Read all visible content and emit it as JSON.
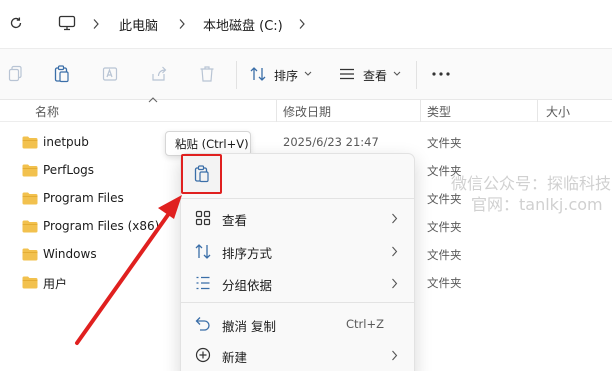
{
  "address_bar": {
    "crumbs": [
      "此电脑",
      "本地磁盘 (C:)"
    ]
  },
  "toolbar": {
    "sort_label": "排序",
    "view_label": "查看"
  },
  "columns": {
    "name": "名称",
    "date": "修改日期",
    "type": "类型",
    "size": "大小"
  },
  "files": [
    {
      "name": "inetpub",
      "date": "2025/6/23 21:47",
      "type": "文件夹"
    },
    {
      "name": "PerfLogs",
      "date": "",
      "type": "文件夹"
    },
    {
      "name": "Program Files",
      "date": "",
      "type": "文件夹"
    },
    {
      "name": "Program Files (x86)",
      "date": "",
      "type": "文件夹"
    },
    {
      "name": "Windows",
      "date": "",
      "type": "文件夹"
    },
    {
      "name": "用户",
      "date": "",
      "type": "文件夹"
    }
  ],
  "tooltip": {
    "text": "粘贴 (Ctrl+V)"
  },
  "context_menu": {
    "items": [
      {
        "label": "查看",
        "icon": "grid-view-icon",
        "submenu": true
      },
      {
        "label": "排序方式",
        "icon": "sort-icon",
        "submenu": true
      },
      {
        "label": "分组依据",
        "icon": "group-by-icon",
        "submenu": true
      },
      {
        "label": "撤消 复制",
        "icon": "undo-icon",
        "shortcut": "Ctrl+Z"
      },
      {
        "label": "新建",
        "icon": "new-icon",
        "submenu": true
      }
    ]
  },
  "watermark": {
    "line1": "微信公众号：探临科技",
    "line2": "官网：tanlkj.com"
  },
  "colors": {
    "folder": "#F2C14E",
    "highlight_red": "#E0201F",
    "accent_blue": "#2B6CC4"
  }
}
